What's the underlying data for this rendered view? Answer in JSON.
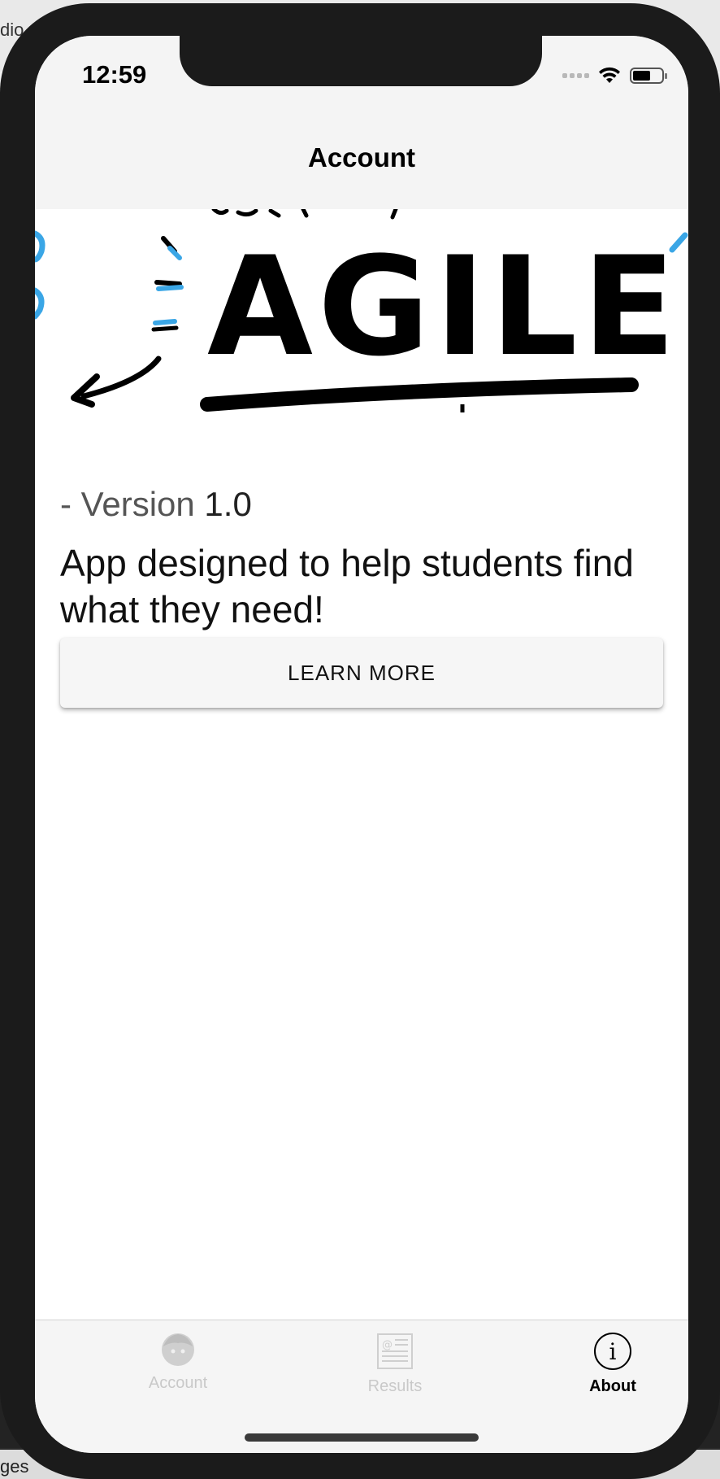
{
  "background": {
    "top_left_text": "dio",
    "bottom_left_text": "ges"
  },
  "status_bar": {
    "time": "12:59",
    "icons": [
      "signal-icon",
      "wifi-icon",
      "battery-icon"
    ]
  },
  "header": {
    "title": "Account"
  },
  "banner": {
    "text": "AGILE",
    "accent_color": "#3aa6e6"
  },
  "content": {
    "version_prefix": "- Version",
    "version_number": "1.0",
    "description": "App designed to help students find what they need!",
    "button_label": "LEARN MORE"
  },
  "tab_bar": {
    "tabs": [
      {
        "label": "Account",
        "icon": "face-icon",
        "active": false
      },
      {
        "label": "Results",
        "icon": "document-list-icon",
        "active": false
      },
      {
        "label": "About",
        "icon": "info-circle-icon",
        "active": true
      }
    ]
  }
}
